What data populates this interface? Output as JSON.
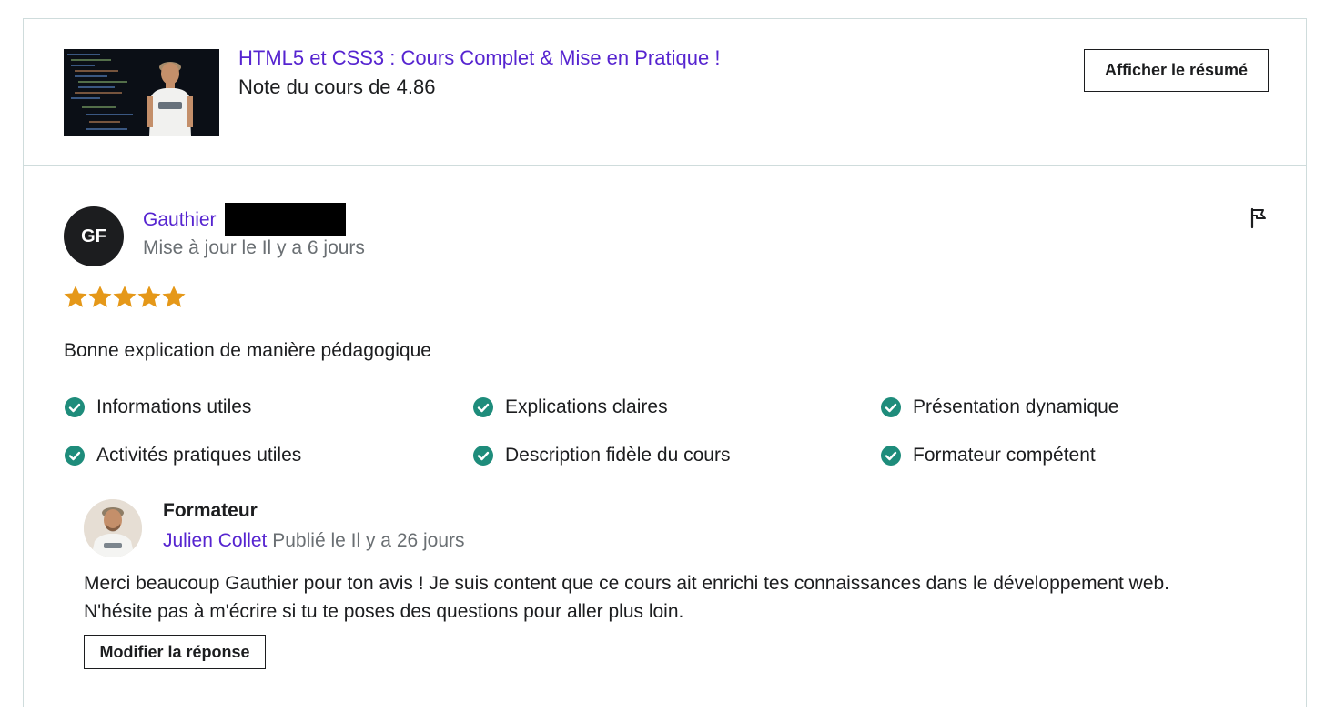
{
  "course": {
    "title": "HTML5 et CSS3 : Cours Complet & Mise en Pratique !",
    "rating_text": "Note du cours de 4.86",
    "summary_button": "Afficher le résumé"
  },
  "review": {
    "initials": "GF",
    "name": "Gauthier",
    "updated": "Mise à jour le Il y a 6 jours",
    "stars": 5,
    "text": "Bonne explication de manière pédagogique",
    "tags": [
      "Informations utiles",
      "Explications claires",
      "Présentation dynamique",
      "Activités pratiques utiles",
      "Description fidèle du cours",
      "Formateur compétent"
    ]
  },
  "response": {
    "role": "Formateur",
    "instructor_name": "Julien Collet",
    "published": "Publié le Il y a 26 jours",
    "line1": "Merci beaucoup Gauthier pour ton avis ! Je suis content que ce cours ait enrichi tes connaissances dans le développement web.",
    "line2": "N'hésite pas à m'écrire si tu te poses des questions pour aller plus loin.",
    "edit_button": "Modifier la réponse"
  },
  "colors": {
    "link": "#5624d0",
    "star": "#e59819",
    "check": "#1e8c7b",
    "muted": "#6a6f73"
  }
}
